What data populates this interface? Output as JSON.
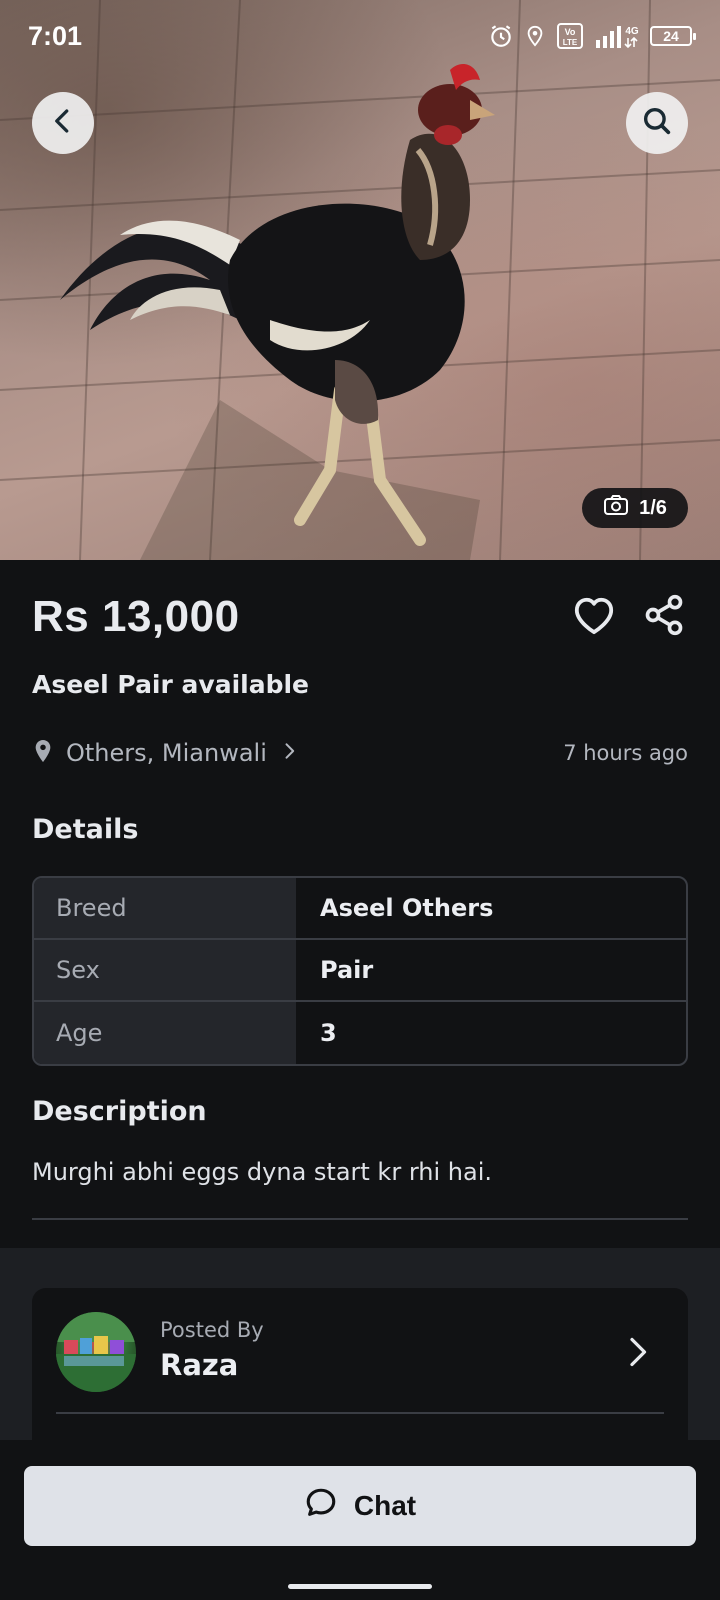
{
  "status_bar": {
    "time": "7:01",
    "battery": "24",
    "network": "4G",
    "volte": "Vo LTE"
  },
  "gallery": {
    "counter": "1/6"
  },
  "listing": {
    "price": "Rs 13,000",
    "title": "Aseel Pair available",
    "location": "Others, Mianwali",
    "posted_ago": "7 hours ago"
  },
  "details": {
    "heading": "Details",
    "rows": [
      {
        "key": "Breed",
        "value": "Aseel Others"
      },
      {
        "key": "Sex",
        "value": "Pair"
      },
      {
        "key": "Age",
        "value": "3"
      }
    ]
  },
  "description": {
    "heading": "Description",
    "text": "Murghi abhi eggs dyna start kr rhi hai."
  },
  "seller": {
    "posted_by_label": "Posted By",
    "name": "Raza"
  },
  "footer": {
    "chat_label": "Chat"
  },
  "icons": {
    "back": "chevron-left-icon",
    "search": "search-icon",
    "camera": "camera-icon",
    "favorite": "heart-icon",
    "share": "share-icon",
    "location": "location-pin-icon",
    "chat": "chat-bubble-icon"
  },
  "colors": {
    "background": "#111214",
    "chat_button": "#dfe2e8",
    "muted_text": "#b3b7bf"
  }
}
